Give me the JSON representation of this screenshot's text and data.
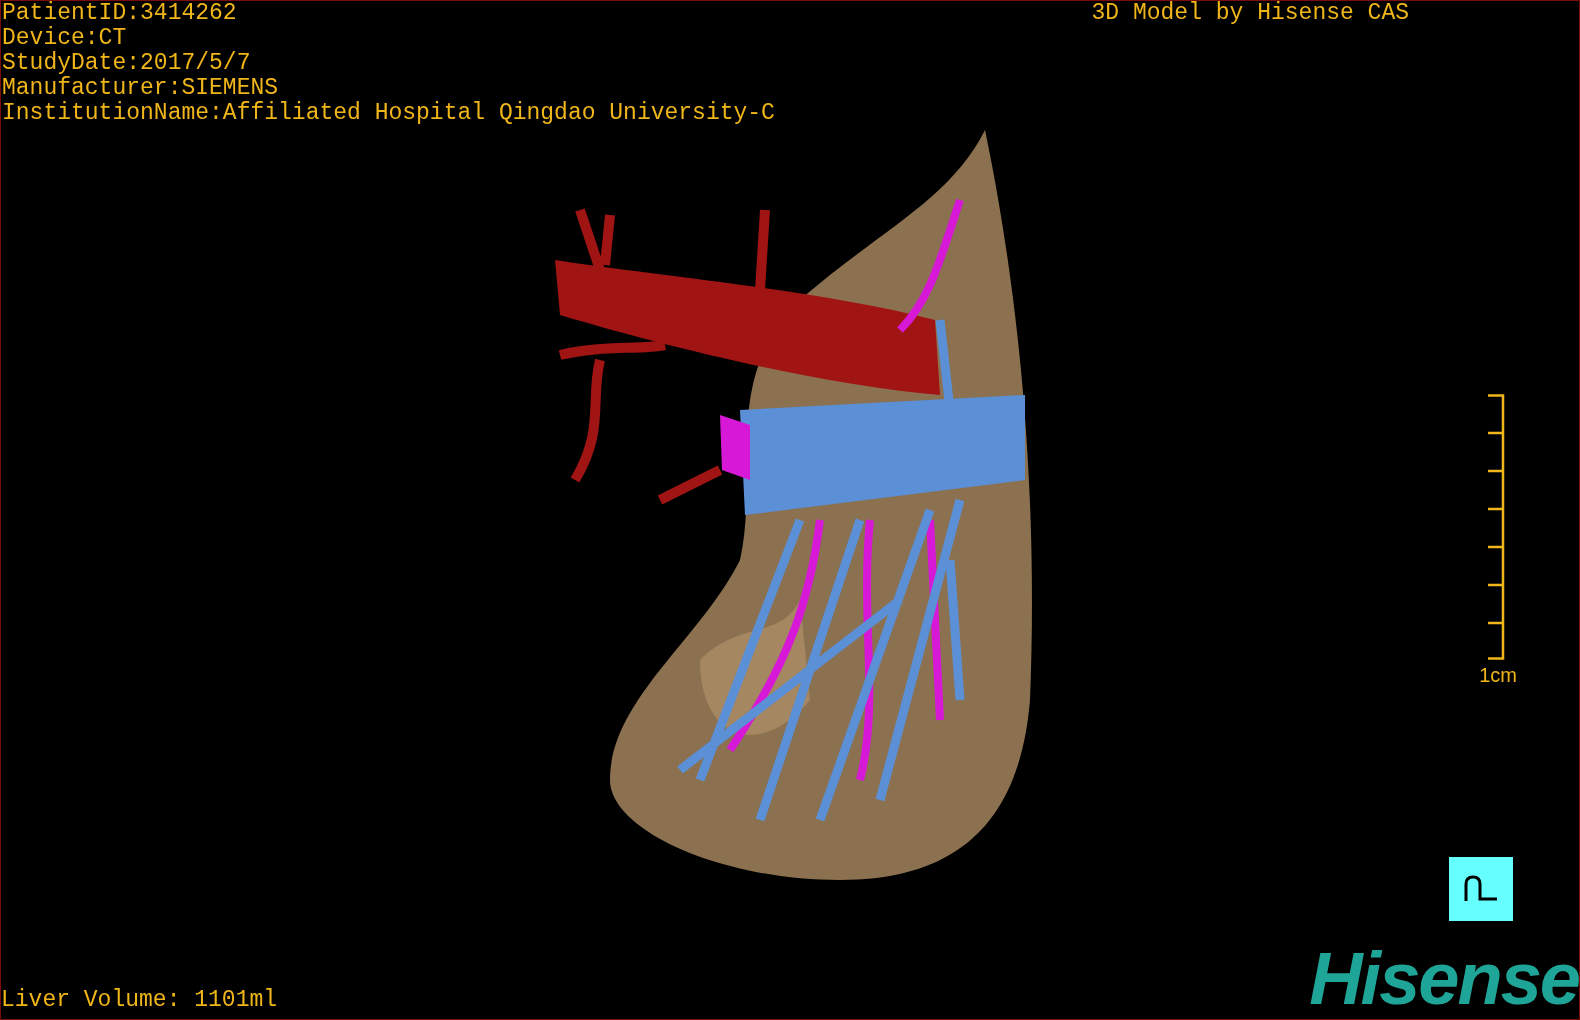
{
  "info_lines": [
    "PatientID:3414262",
    "Device:CT",
    "StudyDate:2017/5/7",
    "Manufacturer:SIEMENS",
    "InstitutionName:Affiliated Hospital Qingdao University-C"
  ],
  "title": "3D Model by Hisense CAS",
  "scale_bar": {
    "label": "1cm"
  },
  "liver_volume": "Liver Volume: 1101ml",
  "logo": "Hisense"
}
